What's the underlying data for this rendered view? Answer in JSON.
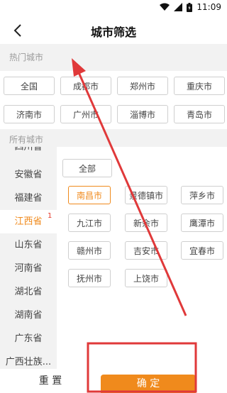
{
  "status": {
    "time": "11:09"
  },
  "header": {
    "title": "城市筛选"
  },
  "hot": {
    "label": "热门城市",
    "cities": [
      "全国",
      "成都市",
      "郑州市",
      "重庆市",
      "济南市",
      "广州市",
      "淄博市",
      "青岛市"
    ]
  },
  "all": {
    "label": "所有城市"
  },
  "provinces": [
    "四川省",
    "安徽省",
    "福建省",
    "江西省",
    "山东省",
    "河南省",
    "湖北省",
    "湖南省",
    "广东省",
    "广西壮族..."
  ],
  "selected_province_badge": "1",
  "cities": {
    "all_label": "全部",
    "list": [
      "南昌市",
      "景德镇市",
      "萍乡市",
      "九江市",
      "新余市",
      "鹰潭市",
      "赣州市",
      "吉安市",
      "宜春市",
      "抚州市",
      "上饶市"
    ],
    "selected": "南昌市"
  },
  "footer": {
    "reset_label": "重 置",
    "confirm_label": "确 定"
  },
  "colors": {
    "accent": "#f08a1c",
    "annotation": "#e0393a"
  }
}
